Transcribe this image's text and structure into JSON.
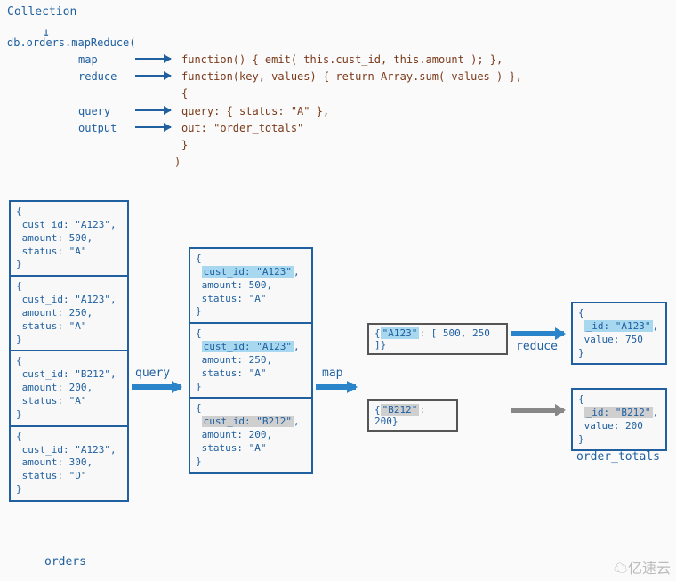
{
  "header": {
    "collection_label": "Collection",
    "db_call": "db.orders.mapReduce(",
    "params": [
      {
        "name": "map",
        "body": "function() { emit( this.cust_id, this.amount ); },"
      },
      {
        "name": "reduce",
        "body": "function(key, values) { return Array.sum( values ) },"
      },
      {
        "name": "",
        "body": "{"
      },
      {
        "name": "query",
        "body": "  query: { status: \"A\" },"
      },
      {
        "name": "output",
        "body": "  out: \"order_totals\""
      },
      {
        "name": "",
        "body": "}"
      },
      {
        "name": "",
        "body": ")"
      }
    ]
  },
  "stage_labels": {
    "query": "query",
    "map": "map",
    "reduce": "reduce"
  },
  "orders_caption": "orders",
  "totals_caption": "order_totals",
  "orders_docs": [
    {
      "cust_id": "\"A123\"",
      "amount": "500",
      "status": "\"A\""
    },
    {
      "cust_id": "\"A123\"",
      "amount": "250",
      "status": "\"A\""
    },
    {
      "cust_id": "\"B212\"",
      "amount": "200",
      "status": "\"A\""
    },
    {
      "cust_id": "\"A123\"",
      "amount": "300",
      "status": "\"D\""
    }
  ],
  "filtered_docs": [
    {
      "hl": "a",
      "cust_id": "\"A123\"",
      "amount": "500",
      "status": "\"A\""
    },
    {
      "hl": "a",
      "cust_id": "\"A123\"",
      "amount": "250",
      "status": "\"A\""
    },
    {
      "hl": "b",
      "cust_id": "\"B212\"",
      "amount": "200",
      "status": "\"A\""
    }
  ],
  "mapped": {
    "a": {
      "key": "\"A123\"",
      "vals": "[ 500, 250 ]"
    },
    "b": {
      "key": "\"B212\"",
      "val": "200"
    }
  },
  "results": [
    {
      "hl": "a",
      "id": "\"A123\"",
      "value": "750"
    },
    {
      "hl": "b",
      "id": "\"B212\"",
      "value": "200"
    }
  ],
  "watermark": "亿速云",
  "chart_data": {
    "type": "table",
    "title": "MongoDB mapReduce flow: orders → order_totals",
    "input_collection": "orders",
    "output_collection": "order_totals",
    "query_filter": {
      "status": "A"
    },
    "map_fn": "emit(this.cust_id, this.amount)",
    "reduce_fn": "Array.sum(values)",
    "input_documents": [
      {
        "cust_id": "A123",
        "amount": 500,
        "status": "A"
      },
      {
        "cust_id": "A123",
        "amount": 250,
        "status": "A"
      },
      {
        "cust_id": "B212",
        "amount": 200,
        "status": "A"
      },
      {
        "cust_id": "A123",
        "amount": 300,
        "status": "D"
      }
    ],
    "after_query": [
      {
        "cust_id": "A123",
        "amount": 500,
        "status": "A"
      },
      {
        "cust_id": "A123",
        "amount": 250,
        "status": "A"
      },
      {
        "cust_id": "B212",
        "amount": 200,
        "status": "A"
      }
    ],
    "after_map": [
      {
        "key": "A123",
        "values": [
          500,
          250
        ]
      },
      {
        "key": "B212",
        "values": [
          200
        ]
      }
    ],
    "after_reduce": [
      {
        "_id": "A123",
        "value": 750
      },
      {
        "_id": "B212",
        "value": 200
      }
    ]
  }
}
